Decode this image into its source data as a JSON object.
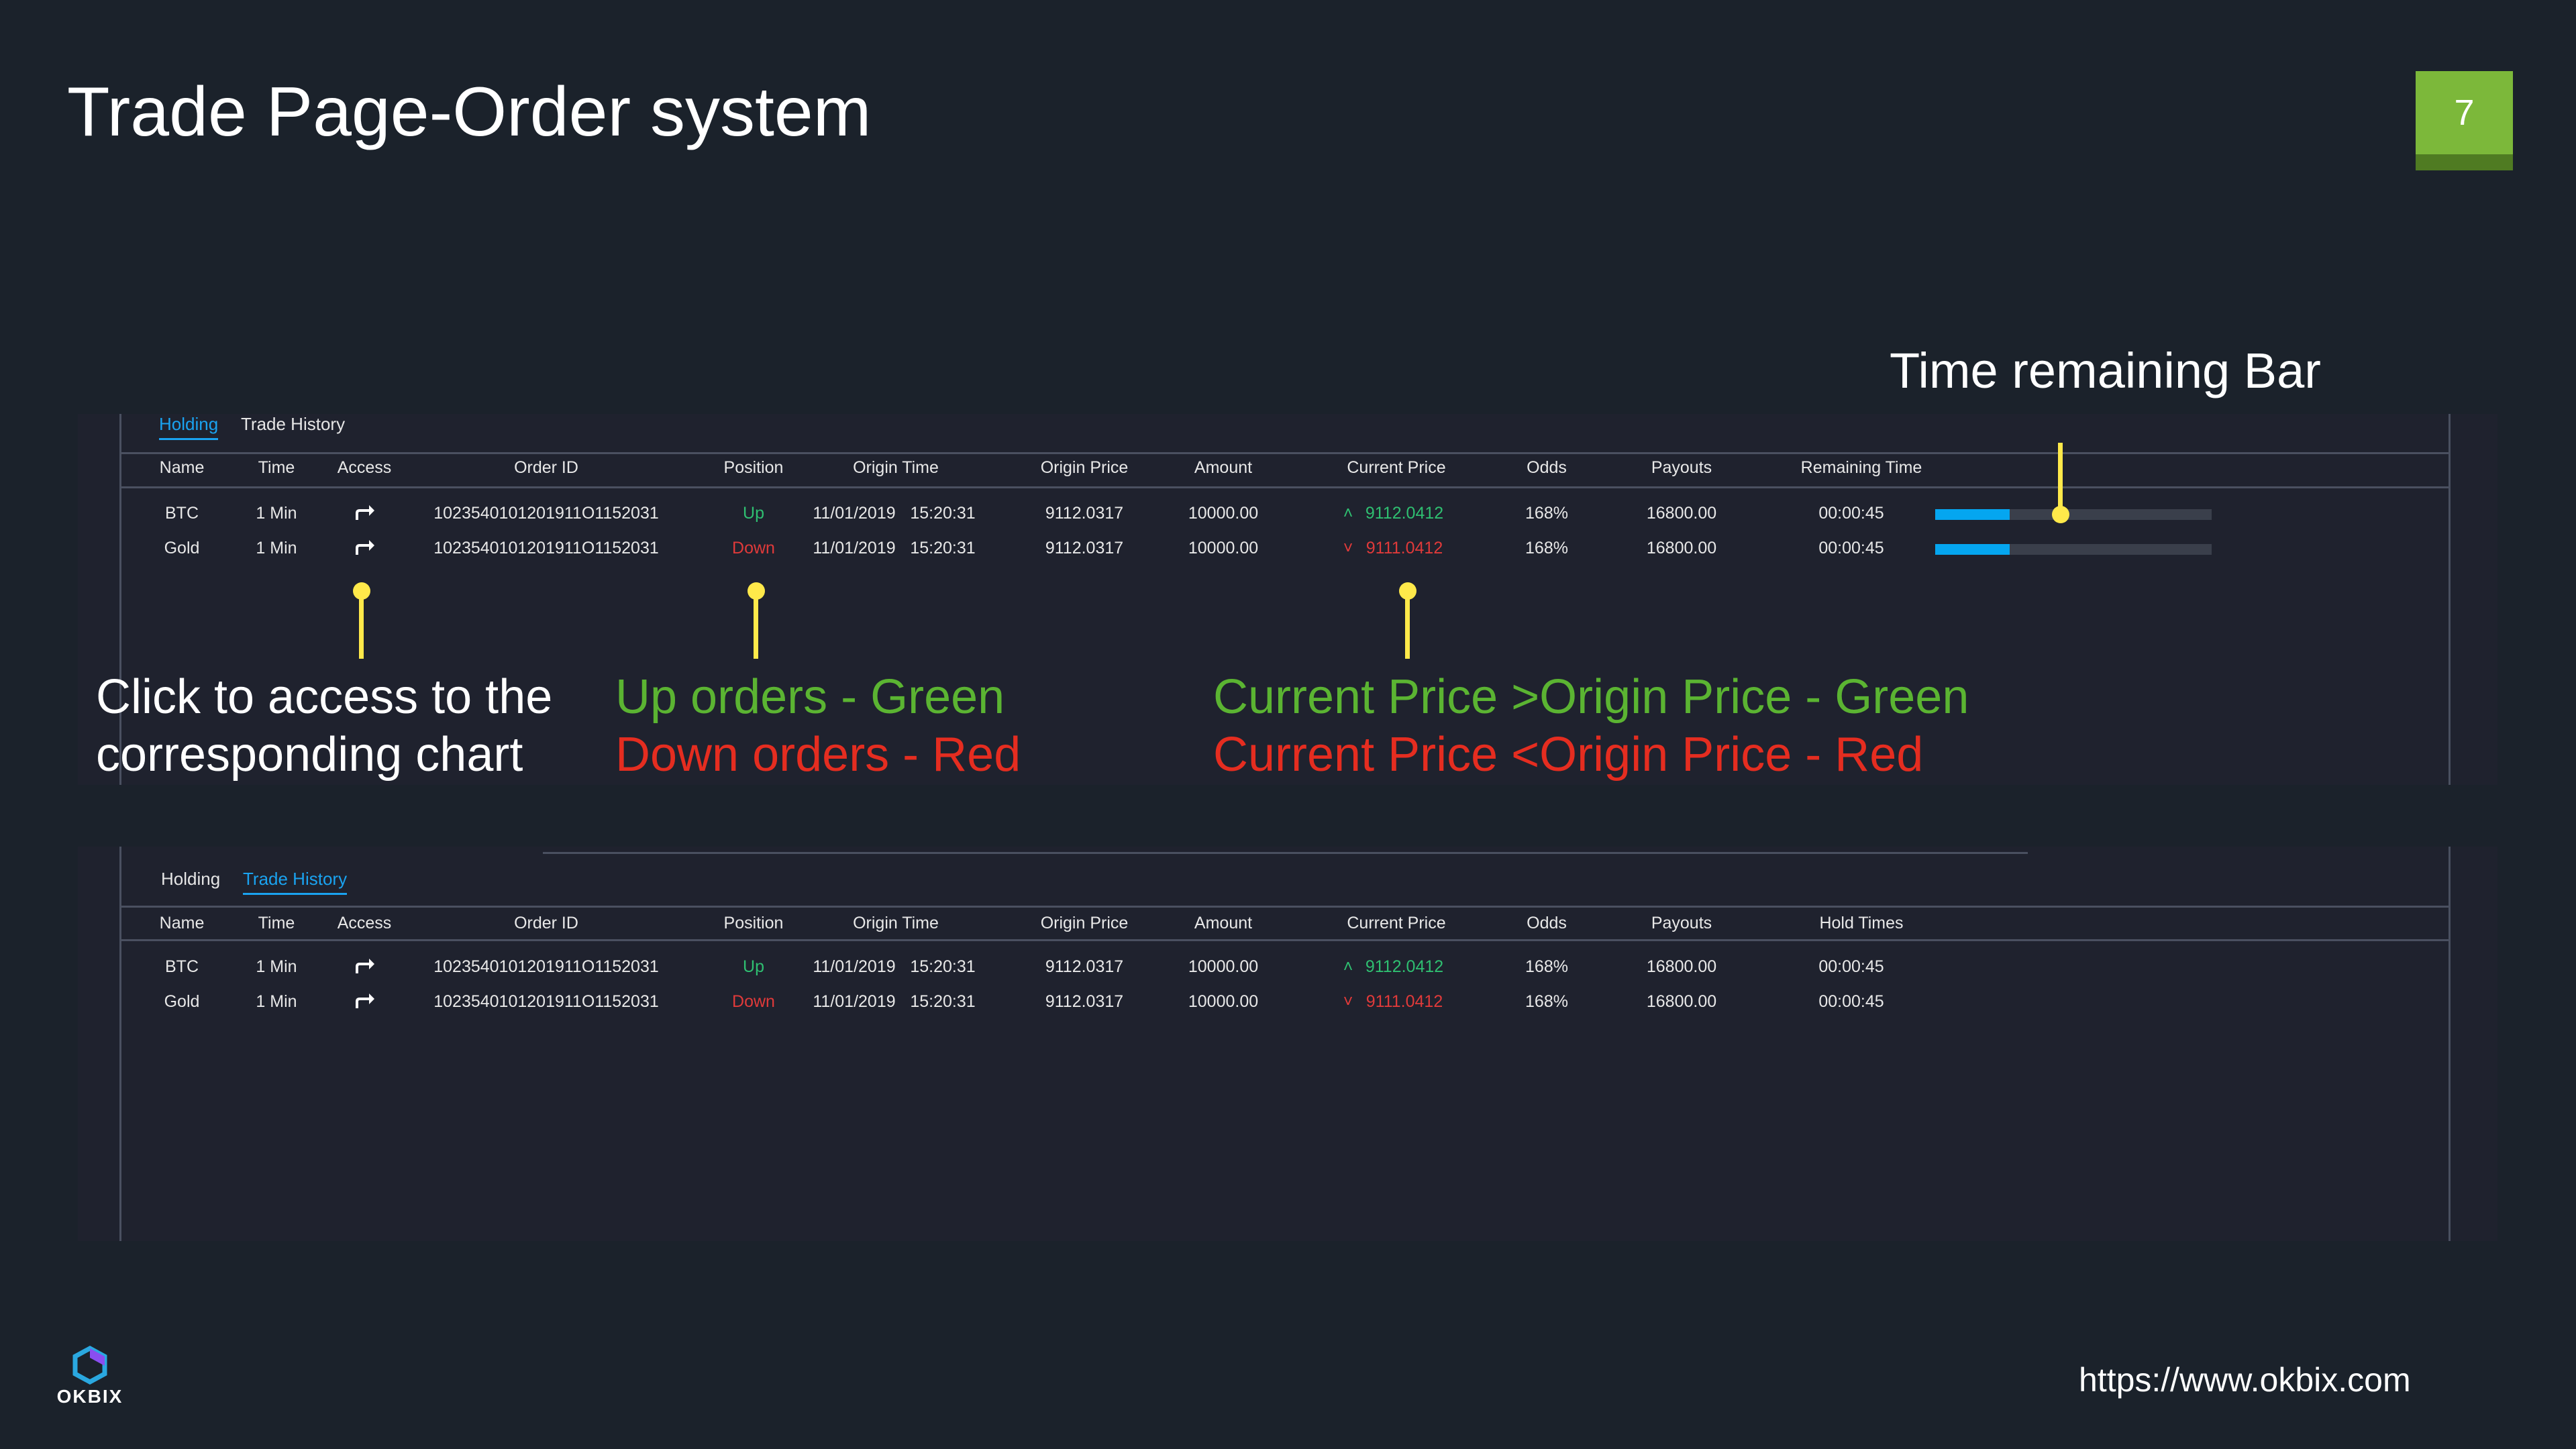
{
  "slide": {
    "title": "Trade Page-Order system",
    "page_number": "7",
    "url": "https://www.okbix.com",
    "logo_text": "OKBIX"
  },
  "colors": {
    "background": "#1b222b",
    "panel": "#1f222e",
    "accent_blue": "#1aa3f0",
    "up_green": "#2fbf71",
    "down_red": "#e03a3a",
    "callout_yellow": "#ffe94a",
    "badge_green": "#7cb83a"
  },
  "holding_panel": {
    "tabs": [
      {
        "label": "Holding",
        "active": true
      },
      {
        "label": "Trade History",
        "active": false
      }
    ],
    "columns": [
      "Name",
      "Time",
      "Access",
      "Order ID",
      "Position",
      "Origin Time",
      "Origin Price",
      "Amount",
      "Current Price",
      "Odds",
      "Payouts",
      "Remaining Time"
    ],
    "rows": [
      {
        "name": "BTC",
        "time": "1 Min",
        "access_icon": "share-arrow-icon",
        "order_id": "1023540101201911O1152031",
        "position": "Up",
        "origin_date": "11/01/2019",
        "origin_clock": "15:20:31",
        "origin_price": "9112.0317",
        "amount": "10000.00",
        "current_price": "9112.0412",
        "direction": "up",
        "odds": "168%",
        "payouts": "16800.00",
        "remaining": "00:00:45",
        "remaining_fraction": 0.27
      },
      {
        "name": "Gold",
        "time": "1 Min",
        "access_icon": "share-arrow-icon",
        "order_id": "1023540101201911O1152031",
        "position": "Down",
        "origin_date": "11/01/2019",
        "origin_clock": "15:20:31",
        "origin_price": "9112.0317",
        "amount": "10000.00",
        "current_price": "9111.0412",
        "direction": "down",
        "odds": "168%",
        "payouts": "16800.00",
        "remaining": "00:00:45",
        "remaining_fraction": 0.27
      }
    ]
  },
  "history_panel": {
    "tabs": [
      {
        "label": "Holding",
        "active": false
      },
      {
        "label": "Trade History",
        "active": true
      }
    ],
    "columns": [
      "Name",
      "Time",
      "Access",
      "Order ID",
      "Position",
      "Origin Time",
      "Origin Price",
      "Amount",
      "Current Price",
      "Odds",
      "Payouts",
      "Hold Times"
    ],
    "rows": [
      {
        "name": "BTC",
        "time": "1 Min",
        "access_icon": "share-arrow-icon",
        "order_id": "1023540101201911O1152031",
        "position": "Up",
        "origin_date": "11/01/2019",
        "origin_clock": "15:20:31",
        "origin_price": "9112.0317",
        "amount": "10000.00",
        "current_price": "9112.0412",
        "direction": "up",
        "odds": "168%",
        "payouts": "16800.00",
        "hold": "00:00:45"
      },
      {
        "name": "Gold",
        "time": "1 Min",
        "access_icon": "share-arrow-icon",
        "order_id": "1023540101201911O1152031",
        "position": "Down",
        "origin_date": "11/01/2019",
        "origin_clock": "15:20:31",
        "origin_price": "9112.0317",
        "amount": "10000.00",
        "current_price": "9111.0412",
        "direction": "down",
        "odds": "168%",
        "payouts": "16800.00",
        "hold": "00:00:45"
      }
    ]
  },
  "annotations": {
    "time_bar": "Time remaining Bar",
    "access_line1": "Click to access to the",
    "access_line2": "corresponding chart",
    "up_orders": "Up orders - Green",
    "down_orders": "Down orders - Red",
    "price_up": "Current Price >Origin Price - Green",
    "price_down": "Current Price <Origin Price - Red"
  }
}
